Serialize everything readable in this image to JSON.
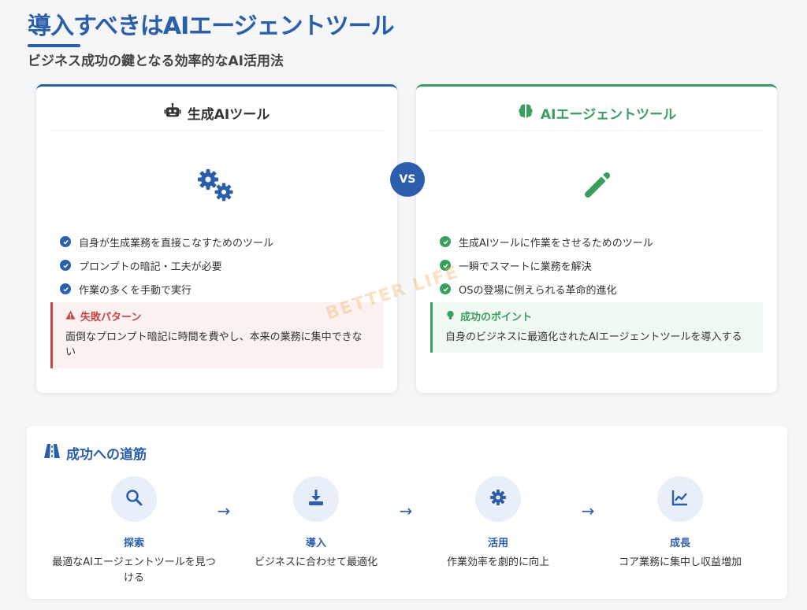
{
  "header": {
    "title": "導入すべきはAIエージェントツール",
    "subtitle": "ビジネス成功の鍵となる効率的なAI活用法"
  },
  "left_card": {
    "title": "生成AIツール",
    "icon": "robot-icon",
    "big_icon": "gears-icon",
    "features": [
      "自身が生成業務を直接こなすためのツール",
      "プロンプトの暗記・工夫が必要",
      "作業の多くを手動で実行"
    ],
    "callout": {
      "title": "失敗パターン",
      "icon": "warning-icon",
      "body": "面倒なプロンプト暗記に時間を費やし、本来の業務に集中できない"
    }
  },
  "vs_label": "VS",
  "right_card": {
    "title": "AIエージェントツール",
    "icon": "brain-icon",
    "big_icon": "wand-icon",
    "features": [
      "生成AIツールに作業をさせるためのツール",
      "一瞬でスマートに業務を解決",
      "OSの登場に例えられる革命的進化"
    ],
    "callout": {
      "title": "成功のポイント",
      "icon": "lightbulb-icon",
      "body": "自身のビジネスに最適化されたAIエージェントツールを導入する"
    }
  },
  "watermark": "BETTER LIFE",
  "path": {
    "title": "成功への道筋",
    "icon": "road-icon",
    "arrow": "→",
    "steps": [
      {
        "label": "探索",
        "desc": "最適なAIエージェントツールを見つける",
        "icon": "search-icon"
      },
      {
        "label": "導入",
        "desc": "ビジネスに合わせて最適化",
        "icon": "download-icon"
      },
      {
        "label": "活用",
        "desc": "作業効率を劇的に向上",
        "icon": "gear-icon"
      },
      {
        "label": "成長",
        "desc": "コア業務に集中し収益増加",
        "icon": "chart-line-icon"
      }
    ]
  },
  "colors": {
    "primary": "#2b5eab",
    "success": "#3a9e5f",
    "danger": "#c94444"
  }
}
